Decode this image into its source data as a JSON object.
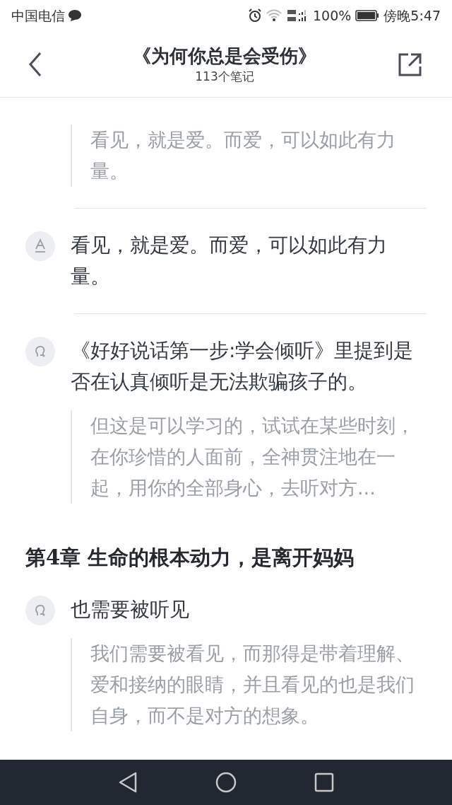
{
  "status_bar": {
    "carrier": "中国电信",
    "battery": "100%",
    "time": "傍晚5:47"
  },
  "header": {
    "title": "《为何你总是会受伤》",
    "subtitle": "113个笔记"
  },
  "items": [
    {
      "kind": "quote",
      "text": "看见，就是爱。而爱，可以如此有力量。"
    },
    {
      "kind": "divider"
    },
    {
      "kind": "underline_note",
      "text": "看见，就是爱。而爱，可以如此有力量。"
    },
    {
      "kind": "divider"
    },
    {
      "kind": "thought_note",
      "text": "《好好说话第一步:学会倾听》里提到是否在认真倾听是无法欺骗孩子的。"
    },
    {
      "kind": "quote",
      "text": "但这是可以学习的，试试在某些时刻，在你珍惜的人面前，全神贯注地在一起，用你的全部身心，去听对方..."
    },
    {
      "kind": "chapter",
      "text": "第4章 生命的根本动力，是离开妈妈"
    },
    {
      "kind": "thought_note",
      "text": "也需要被听见"
    },
    {
      "kind": "quote",
      "text": "我们需要被看见，而那得是带着理解、爱和接纳的眼睛，并且看见的也是我们自身，而不是对方的想象。"
    }
  ]
}
